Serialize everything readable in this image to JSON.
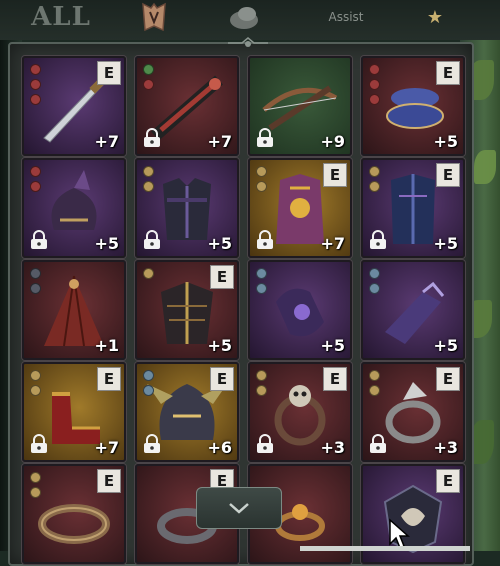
{
  "tabs": {
    "all_label": "ALL",
    "armor_icon": "armor-tab-icon",
    "accessory_icon": "accessory-tab-icon",
    "assist_label": "Assist",
    "favorite_icon": "star-icon"
  },
  "inventory": {
    "items": [
      {
        "name": "dagger",
        "enhanced": true,
        "badge": "E",
        "level": "+7",
        "locked": false,
        "gems": [
          "#9b3b3b",
          "#9b3b3b",
          "#9b3b3b"
        ],
        "bg": "purple"
      },
      {
        "name": "crimson-staff",
        "enhanced": false,
        "badge": "",
        "level": "+7",
        "locked": true,
        "gems": [
          "#4f8a4b",
          "#9b3b3b"
        ],
        "bg": "red"
      },
      {
        "name": "crossbow",
        "enhanced": false,
        "badge": "",
        "level": "+9",
        "locked": true,
        "gems": [],
        "bg": "green"
      },
      {
        "name": "blue-cuffs",
        "enhanced": true,
        "badge": "E",
        "level": "+5",
        "locked": false,
        "gems": [
          "#9b3b3b",
          "#9b3b3b",
          "#9b3b3b"
        ],
        "bg": "red"
      },
      {
        "name": "shadow-helm",
        "enhanced": false,
        "badge": "",
        "level": "+5",
        "locked": true,
        "gems": [
          "#9b3b3b",
          "#9b3b3b"
        ],
        "bg": "purple"
      },
      {
        "name": "dark-armor",
        "enhanced": false,
        "badge": "",
        "level": "+5",
        "locked": true,
        "gems": [
          "#b79a5a",
          "#b79a5a"
        ],
        "bg": "purple"
      },
      {
        "name": "royal-robe",
        "enhanced": true,
        "badge": "E",
        "level": "+7",
        "locked": true,
        "gems": [
          "#b79a5a",
          "#b79a5a"
        ],
        "bg": "gold"
      },
      {
        "name": "blue-coat",
        "enhanced": true,
        "badge": "E",
        "level": "+5",
        "locked": true,
        "gems": [
          "#b79a5a",
          "#b79a5a"
        ],
        "bg": "purple"
      },
      {
        "name": "red-cloak",
        "enhanced": false,
        "badge": "",
        "level": "+1",
        "locked": false,
        "gems": [
          "#555a66",
          "#555a66"
        ],
        "bg": "red"
      },
      {
        "name": "spiked-plate",
        "enhanced": true,
        "badge": "E",
        "level": "+5",
        "locked": false,
        "gems": [
          "#b79a5a"
        ],
        "bg": "red"
      },
      {
        "name": "violet-gloves",
        "enhanced": false,
        "badge": "",
        "level": "+5",
        "locked": false,
        "gems": [
          "#6b8aa0",
          "#6b8aa0"
        ],
        "bg": "purple"
      },
      {
        "name": "violet-gauntlet",
        "enhanced": false,
        "badge": "",
        "level": "+5",
        "locked": false,
        "gems": [
          "#6b8aa0",
          "#6b8aa0"
        ],
        "bg": "purple"
      },
      {
        "name": "gold-boots",
        "enhanced": true,
        "badge": "E",
        "level": "+7",
        "locked": true,
        "gems": [
          "#b79a5a",
          "#b79a5a"
        ],
        "bg": "gold"
      },
      {
        "name": "dragon-helm",
        "enhanced": true,
        "badge": "E",
        "level": "+6",
        "locked": true,
        "gems": [
          "#6b8aa0",
          "#6b8aa0"
        ],
        "bg": "gold"
      },
      {
        "name": "skull-ring",
        "enhanced": true,
        "badge": "E",
        "level": "+3",
        "locked": true,
        "gems": [
          "#b79a5a",
          "#b79a5a"
        ],
        "bg": "red"
      },
      {
        "name": "silver-ring",
        "enhanced": true,
        "badge": "E",
        "level": "+3",
        "locked": true,
        "gems": [
          "#b79a5a",
          "#b79a5a"
        ],
        "bg": "red"
      },
      {
        "name": "bronze-bracelet",
        "enhanced": true,
        "badge": "E",
        "level": "",
        "locked": false,
        "gems": [
          "#b79a5a",
          "#b79a5a"
        ],
        "bg": "red"
      },
      {
        "name": "iron-ring",
        "enhanced": true,
        "badge": "E",
        "level": "",
        "locked": false,
        "gems": [],
        "bg": "red"
      },
      {
        "name": "amber-ring",
        "enhanced": false,
        "badge": "",
        "level": "",
        "locked": false,
        "gems": [],
        "bg": "red"
      },
      {
        "name": "crest-amulet",
        "enhanced": true,
        "badge": "E",
        "level": "",
        "locked": false,
        "gems": [],
        "bg": "purple"
      }
    ]
  },
  "scroll": {
    "icon": "chevron-down-icon"
  },
  "colors": {
    "purple": "#3a2546",
    "red": "#4a2327",
    "gold": "#6b4f1c",
    "green": "#26402c",
    "badge_bg": "#e9e6df",
    "panel": "#2f3532"
  }
}
